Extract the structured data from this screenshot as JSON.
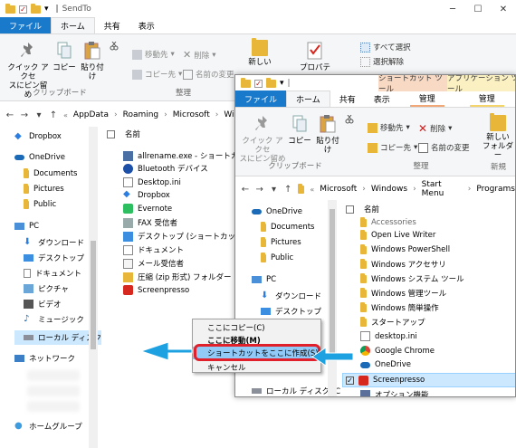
{
  "back_window": {
    "title": "SendTo",
    "tabs": [
      "ファイル",
      "ホーム",
      "共有",
      "表示"
    ],
    "ribbon": {
      "pin_label_1": "クイック アクセ",
      "pin_label_2": "スにピン留め",
      "copy_label": "コピー",
      "paste_label": "貼り付け",
      "clipboard_group": "クリップボード",
      "move_to": "移動先",
      "copy_to": "コピー先",
      "delete": "削除",
      "rename": "名前の変更",
      "organize_group": "整理",
      "new_folder": "新しい",
      "properties": "プロパティ",
      "select_all": "すべて選択",
      "select_none": "選択解除"
    },
    "breadcrumb": [
      "AppData",
      "Roaming",
      "Microsoft",
      "Wi"
    ],
    "column_name": "名前",
    "nav": [
      "Dropbox",
      "OneDrive",
      "Documents",
      "Pictures",
      "Public",
      "PC",
      "ダウンロード",
      "デスクトップ",
      "ドキュメント",
      "ピクチャ",
      "ビデオ",
      "ミュージック",
      "ローカル ディスク (C",
      "ネットワーク",
      "ホームグループ"
    ],
    "files": [
      "allrename.exe - ショートカット",
      "Bluetooth デバイス",
      "Desktop.ini",
      "Dropbox",
      "Evernote",
      "FAX 受信者",
      "デスクトップ (ショートカットを作成)",
      "ドキュメント",
      "メール受信者",
      "圧縮 (zip 形式) フォルダー",
      "Screenpresso"
    ]
  },
  "front_window": {
    "tabs": [
      "ファイル",
      "ホーム",
      "共有",
      "表示",
      "管理",
      "管理"
    ],
    "context_tab_shortcut": "ショートカット ツール",
    "context_tab_app": "アプリケーション ツール",
    "ribbon": {
      "pin_label_1": "クイック アクセ",
      "pin_label_2": "スにピン留め",
      "copy_label": "コピー",
      "paste_label": "貼り付け",
      "clipboard_group": "クリップボード",
      "move_to": "移動先",
      "copy_to": "コピー先",
      "delete": "削除",
      "rename": "名前の変更",
      "organize_group": "整理",
      "new_folder_1": "新しい",
      "new_folder_2": "フォルダー",
      "new_group": "新規"
    },
    "breadcrumb": [
      "Microsoft",
      "Windows",
      "Start Menu",
      "Programs"
    ],
    "column_name": "名前",
    "nav": [
      "OneDrive",
      "Documents",
      "Pictures",
      "Public",
      "PC",
      "ダウンロード",
      "デスクトップ",
      "ローカル ディスク (C"
    ],
    "files": [
      "Accessories",
      "Open Live Writer",
      "Windows PowerShell",
      "Windows アクセサリ",
      "Windows システム ツール",
      "Windows 管理ツール",
      "Windows 簡単操作",
      "スタートアップ",
      "desktop.ini",
      "Google Chrome",
      "OneDrive",
      "Screenpresso",
      "オプション機能"
    ]
  },
  "context_menu": {
    "items": [
      "ここにコピー(C)",
      "ここに移動(M)",
      "ショートカットをここに作成(S)",
      "キャンセル"
    ]
  },
  "colors": {
    "file_tab": "#1979ca",
    "highlight": "#e0202a",
    "arrow": "#1da1e0",
    "shortcut_tab": "#f7d9c4",
    "app_tab": "#fbf0c2"
  }
}
